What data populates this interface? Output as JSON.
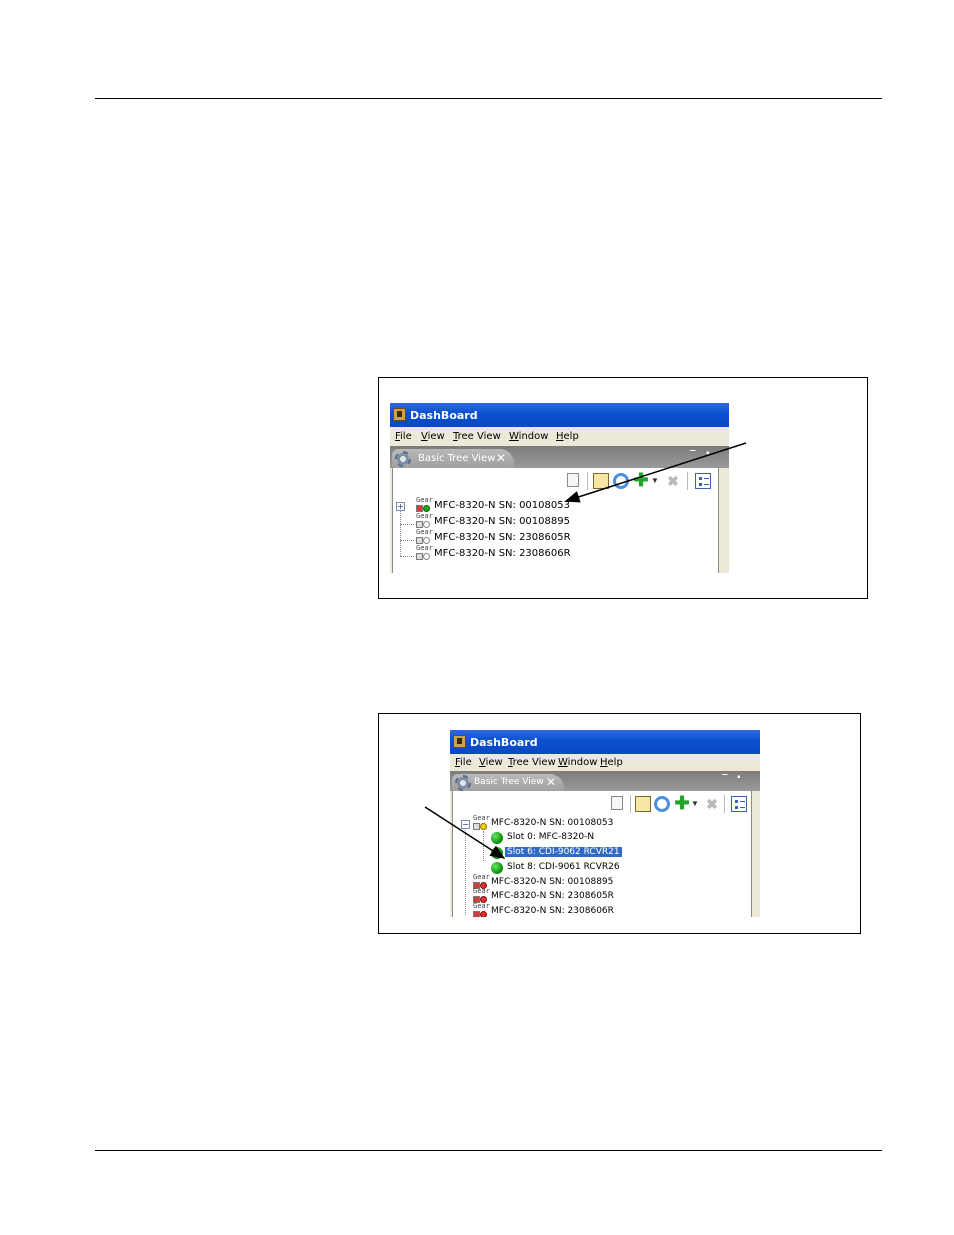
{
  "figure1": {
    "window_title": "DashBoard",
    "menu": [
      "File",
      "View",
      "Tree View",
      "Window",
      "Help"
    ],
    "view_tab": "Basic Tree View",
    "tree": [
      "MFC-8320-N SN: 00108053",
      "MFC-8320-N SN: 00108895",
      "MFC-8320-N SN: 2308605R",
      "MFC-8320-N SN: 2308606R"
    ],
    "gear_label": "Gear"
  },
  "figure2": {
    "window_title": "DashBoard",
    "menu": [
      "File",
      "View",
      "Tree View",
      "Window",
      "Help"
    ],
    "view_tab": "Basic Tree View",
    "tree_root": "MFC-8320-N SN: 00108053",
    "slots": [
      "Slot 0: MFC-8320-N",
      "Slot 6: CDI-9062 RCVR21",
      "Slot 8: CDI-9061 RCVR26"
    ],
    "selected_slot": "Slot 6: CDI-9062 RCVR21",
    "tree_rest": [
      "MFC-8320-N SN: 00108895",
      "MFC-8320-N SN: 2308605R",
      "MFC-8320-N SN: 2308606R"
    ],
    "gear_label": "Gear"
  },
  "colors": {
    "titlebar": "#0a4fd1",
    "selection": "#316ac5",
    "status_green": "#1fa81f"
  }
}
